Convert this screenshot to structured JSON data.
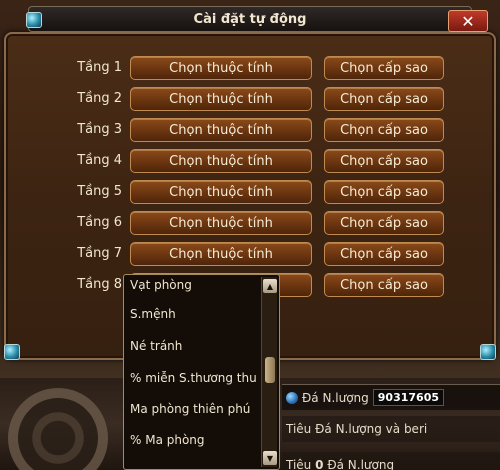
{
  "dialog": {
    "title": "Cài đặt tự động",
    "close_label": "✕"
  },
  "floors": [
    {
      "label": "Tầng 1",
      "attr_label": "Chọn thuộc tính",
      "star_label": "Chọn cấp sao"
    },
    {
      "label": "Tầng 2",
      "attr_label": "Chọn thuộc tính",
      "star_label": "Chọn cấp sao"
    },
    {
      "label": "Tầng 3",
      "attr_label": "Chọn thuộc tính",
      "star_label": "Chọn cấp sao"
    },
    {
      "label": "Tầng 4",
      "attr_label": "Chọn thuộc tính",
      "star_label": "Chọn cấp sao"
    },
    {
      "label": "Tầng 5",
      "attr_label": "Chọn thuộc tính",
      "star_label": "Chọn cấp sao"
    },
    {
      "label": "Tầng 6",
      "attr_label": "Chọn thuộc tính",
      "star_label": "Chọn cấp sao"
    },
    {
      "label": "Tầng 7",
      "attr_label": "Chọn thuộc tính",
      "star_label": "Chọn cấp sao"
    },
    {
      "label": "Tầng 8",
      "attr_label": "",
      "star_label": "Chọn cấp sao"
    }
  ],
  "dropdown": {
    "items": [
      "Vạt phòng",
      "S.mệnh",
      "Né tránh",
      "% miễn S.thương thu",
      "Ma phòng thiên phú",
      "% Ma phòng"
    ],
    "scroll_up": "▲",
    "scroll_down": "▼"
  },
  "bottom": {
    "stone_label": "Đá N.lượng",
    "stone_value": "90317605",
    "spend_label": "Tiêu Đá N.lượng và beri",
    "spend0_prefix": "Tiêu",
    "spend0_value": "0",
    "spend0_suffix": "Đá N.lượng"
  }
}
